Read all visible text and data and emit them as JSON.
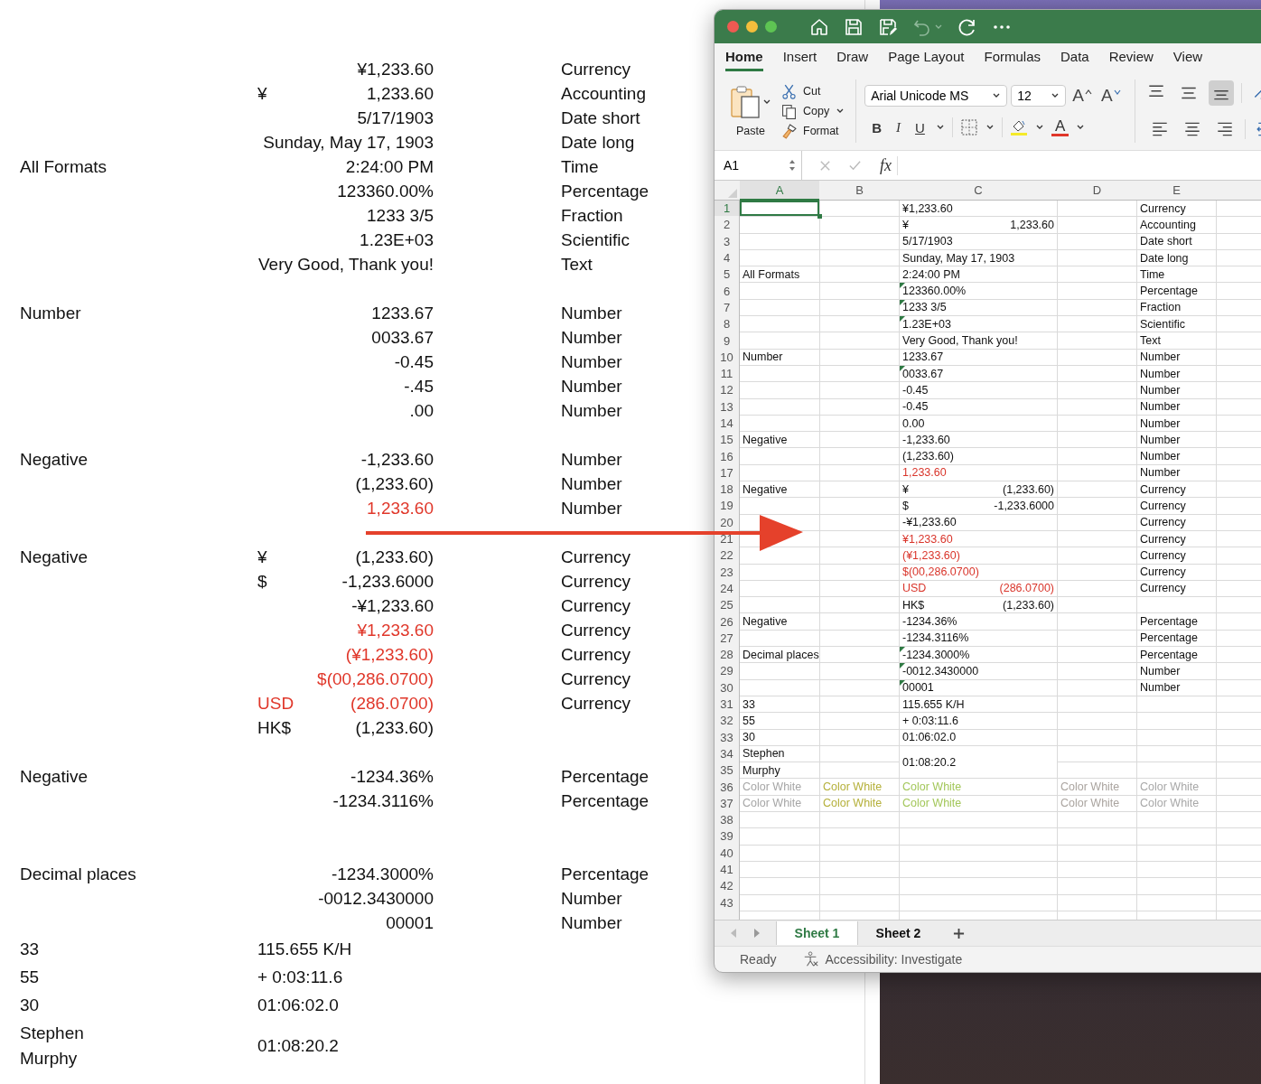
{
  "document": {
    "rows": [
      {
        "kind": "entry",
        "value": "¥1,233.60",
        "type": "Currency",
        "red": false
      },
      {
        "kind": "entry",
        "symbol": "¥",
        "value": "1,233.60",
        "type": "Accounting",
        "red": false
      },
      {
        "kind": "entry",
        "value": "5/17/1903",
        "type": "Date short",
        "red": false
      },
      {
        "kind": "entry",
        "value": "Sunday, May 17, 1903",
        "type": "Date long",
        "red": false
      },
      {
        "kind": "entry",
        "label": "All Formats",
        "value": "2:24:00 PM",
        "type": "Time",
        "red": false
      },
      {
        "kind": "entry",
        "value": "123360.00%",
        "type": "Percentage",
        "red": false
      },
      {
        "kind": "entry",
        "value": "1233 3/5",
        "type": "Fraction",
        "red": false
      },
      {
        "kind": "entry",
        "value": "1.23E+03",
        "type": "Scientific",
        "red": false
      },
      {
        "kind": "entry",
        "value": "Very Good, Thank you!",
        "type": "Text",
        "red": false
      },
      {
        "kind": "blank"
      },
      {
        "kind": "entry",
        "label": "Number",
        "value": "1233.67",
        "type": "Number",
        "red": false
      },
      {
        "kind": "entry",
        "value": "0033.67",
        "type": "Number",
        "red": false
      },
      {
        "kind": "entry",
        "value": "-0.45",
        "type": "Number",
        "red": false
      },
      {
        "kind": "entry",
        "value": "-.45",
        "type": "Number",
        "red": false
      },
      {
        "kind": "entry",
        "value": ".00",
        "type": "Number",
        "red": false
      },
      {
        "kind": "blank"
      },
      {
        "kind": "entry",
        "label": "Negative",
        "value": "-1,233.60",
        "type": "Number",
        "red": false
      },
      {
        "kind": "entry",
        "value": "(1,233.60)",
        "type": "Number",
        "red": false
      },
      {
        "kind": "entry",
        "value": "1,233.60",
        "type": "Number",
        "red": true
      },
      {
        "kind": "blank"
      },
      {
        "kind": "entry",
        "label": "Negative",
        "symbol": "¥",
        "value": "(1,233.60)",
        "type": "Currency",
        "red": false
      },
      {
        "kind": "entry",
        "symbol": "$",
        "value": "-1,233.6000",
        "type": "Currency",
        "red": false
      },
      {
        "kind": "entry",
        "value": "-¥1,233.60",
        "type": "Currency",
        "red": false
      },
      {
        "kind": "entry",
        "value": "¥1,233.60",
        "type": "Currency",
        "red": true
      },
      {
        "kind": "entry",
        "value": "(¥1,233.60)",
        "type": "Currency",
        "red": true
      },
      {
        "kind": "entry",
        "value": "$(00,286.0700)",
        "type": "Currency",
        "red": true
      },
      {
        "kind": "entry",
        "symbol": "USD",
        "value": "(286.0700)",
        "type": "Currency",
        "red": true
      },
      {
        "kind": "entry",
        "symbol": "HK$",
        "value": "(1,233.60)",
        "red": false
      },
      {
        "kind": "blank"
      },
      {
        "kind": "entry",
        "label": "Negative",
        "value": "-1234.36%",
        "type": "Percentage",
        "red": false
      },
      {
        "kind": "entry",
        "value": "-1234.3116%",
        "type": "Percentage",
        "red": false
      },
      {
        "kind": "blank"
      },
      {
        "kind": "blank"
      },
      {
        "kind": "entry",
        "label": "Decimal places",
        "value": "-1234.3000%",
        "type": "Percentage",
        "red": false
      },
      {
        "kind": "entry",
        "value": "-0012.3430000",
        "type": "Number",
        "red": false
      },
      {
        "kind": "entry",
        "value": "00001",
        "type": "Number",
        "red": false
      },
      {
        "kind": "timing",
        "label_lines": [
          "33"
        ],
        "value": "115.655 K/H"
      },
      {
        "kind": "timing",
        "label_lines": [
          "55"
        ],
        "value": "+ 0:03:11.6"
      },
      {
        "kind": "timing",
        "label_lines": [
          "30"
        ],
        "value": "01:06:02.0"
      },
      {
        "kind": "timing",
        "label_lines": [
          "Stephen",
          "Murphy"
        ],
        "value": "01:08:20.2"
      }
    ]
  },
  "window": {
    "tabs": [
      {
        "label": "Home",
        "selected": true
      },
      {
        "label": "Insert",
        "selected": false
      },
      {
        "label": "Draw",
        "selected": false
      },
      {
        "label": "Page Layout",
        "selected": false
      },
      {
        "label": "Formulas",
        "selected": false
      },
      {
        "label": "Data",
        "selected": false
      },
      {
        "label": "Review",
        "selected": false
      },
      {
        "label": "View",
        "selected": false
      }
    ],
    "ribbon": {
      "paste": "Paste",
      "cut": "Cut",
      "copy": "Copy",
      "format": "Format",
      "font": "Arial Unicode MS",
      "size": "12",
      "grow": "A",
      "shrink": "A",
      "bold": "B",
      "italic": "I",
      "underline": "U",
      "font_color": "A"
    },
    "formula_bar": {
      "name_box": "A1",
      "fx": "fx"
    },
    "sheet": {
      "columns": [
        {
          "label": "A",
          "selected": true
        },
        {
          "label": "B",
          "selected": false
        },
        {
          "label": "C",
          "selected": false
        },
        {
          "label": "D",
          "selected": false
        },
        {
          "label": "E",
          "selected": false
        }
      ],
      "rows": [
        {
          "n": "1",
          "kind": "plain",
          "c": "¥1,233.60",
          "e": "Currency",
          "red": false,
          "flag": false,
          "selected": true
        },
        {
          "n": "2",
          "kind": "plain",
          "c_symbol": "¥",
          "c": "1,233.60",
          "e": "Accounting",
          "red": false,
          "flag": false,
          "selected": false
        },
        {
          "n": "3",
          "kind": "plain",
          "c": "5/17/1903",
          "e": "Date short",
          "red": false,
          "flag": false,
          "selected": false
        },
        {
          "n": "4",
          "kind": "plain",
          "c": "Sunday, May 17, 1903",
          "e": "Date long",
          "red": false,
          "flag": false,
          "selected": false
        },
        {
          "n": "5",
          "kind": "plain",
          "a": "All Formats",
          "c": "2:24:00 PM",
          "e": "Time",
          "red": false,
          "flag": false,
          "selected": false
        },
        {
          "n": "6",
          "kind": "plain",
          "c": "123360.00%",
          "e": "Percentage",
          "red": false,
          "flag": true,
          "selected": false
        },
        {
          "n": "7",
          "kind": "plain",
          "c": "1233 3/5",
          "e": "Fraction",
          "red": false,
          "flag": true,
          "selected": false
        },
        {
          "n": "8",
          "kind": "plain",
          "c": "1.23E+03",
          "e": "Scientific",
          "red": false,
          "flag": true,
          "selected": false
        },
        {
          "n": "9",
          "kind": "plain",
          "c": "Very Good, Thank you!",
          "e": "Text",
          "red": false,
          "flag": false,
          "selected": false
        },
        {
          "n": "10",
          "kind": "plain",
          "a": "Number",
          "c": "1233.67",
          "e": "Number",
          "red": false,
          "flag": false,
          "selected": false
        },
        {
          "n": "11",
          "kind": "plain",
          "c": "0033.67",
          "e": "Number",
          "red": false,
          "flag": true,
          "selected": false
        },
        {
          "n": "12",
          "kind": "plain",
          "c": "-0.45",
          "e": "Number",
          "red": false,
          "flag": false,
          "selected": false
        },
        {
          "n": "13",
          "kind": "plain",
          "c": "-0.45",
          "e": "Number",
          "red": false,
          "flag": false,
          "selected": false
        },
        {
          "n": "14",
          "kind": "plain",
          "c": "0.00",
          "e": "Number",
          "red": false,
          "flag": false,
          "selected": false
        },
        {
          "n": "15",
          "kind": "plain",
          "a": "Negative",
          "c": "-1,233.60",
          "e": "Number",
          "red": false,
          "flag": false,
          "selected": false
        },
        {
          "n": "16",
          "kind": "plain",
          "c": "(1,233.60)",
          "e": "Number",
          "red": false,
          "flag": false,
          "selected": false
        },
        {
          "n": "17",
          "kind": "plain",
          "c": "1,233.60",
          "e": "Number",
          "red": true,
          "flag": false,
          "selected": false
        },
        {
          "n": "18",
          "kind": "plain",
          "a": "Negative",
          "c_symbol": "¥",
          "c": "(1,233.60)",
          "e": "Currency",
          "red": false,
          "flag": false,
          "selected": false
        },
        {
          "n": "19",
          "kind": "plain",
          "c_symbol": "$",
          "c": "-1,233.6000",
          "e": "Currency",
          "red": false,
          "flag": false,
          "selected": false
        },
        {
          "n": "20",
          "kind": "plain",
          "c": "-¥1,233.60",
          "e": "Currency",
          "red": false,
          "flag": false,
          "selected": false
        },
        {
          "n": "21",
          "kind": "plain",
          "c": "¥1,233.60",
          "e": "Currency",
          "red": true,
          "flag": false,
          "selected": false
        },
        {
          "n": "22",
          "kind": "plain",
          "c": "(¥1,233.60)",
          "e": "Currency",
          "red": true,
          "flag": false,
          "selected": false
        },
        {
          "n": "23",
          "kind": "plain",
          "c": "$(00,286.0700)",
          "e": "Currency",
          "red": true,
          "flag": false,
          "selected": false
        },
        {
          "n": "24",
          "kind": "plain",
          "c_symbol": "USD",
          "c": "(286.0700)",
          "e": "Currency",
          "red": true,
          "flag": false,
          "selected": false
        },
        {
          "n": "25",
          "kind": "plain",
          "c_symbol": "HK$",
          "c": "(1,233.60)",
          "red": false,
          "flag": false,
          "selected": false
        },
        {
          "n": "26",
          "kind": "plain",
          "a": "Negative",
          "c": "-1234.36%",
          "e": "Percentage",
          "red": false,
          "flag": false,
          "selected": false
        },
        {
          "n": "27",
          "kind": "plain",
          "c": "-1234.3116%",
          "e": "Percentage",
          "red": false,
          "flag": false,
          "selected": false
        },
        {
          "n": "28",
          "kind": "plain",
          "a": "Decimal places",
          "c": "-1234.3000%",
          "e": "Percentage",
          "red": false,
          "flag": true,
          "selected": false
        },
        {
          "n": "29",
          "kind": "plain",
          "c": "-0012.3430000",
          "e": "Number",
          "red": false,
          "flag": true,
          "selected": false
        },
        {
          "n": "30",
          "kind": "plain",
          "c": "00001",
          "e": "Number",
          "red": false,
          "flag": true,
          "selected": false
        },
        {
          "n": "31",
          "kind": "plain",
          "a": "33",
          "c": "115.655 K/H",
          "red": false,
          "flag": false,
          "selected": false
        },
        {
          "n": "32",
          "kind": "plain",
          "a": "55",
          "c": "+ 0:03:11.6",
          "red": false,
          "flag": false,
          "selected": false
        },
        {
          "n": "33",
          "kind": "plain",
          "a": "30",
          "c": "01:06:02.0",
          "red": false,
          "flag": false,
          "selected": false
        },
        {
          "n": "34",
          "kind": "merged",
          "a": "Stephen",
          "c": "01:08:20.2",
          "red": false,
          "flag": false,
          "selected": false
        },
        {
          "n": "35",
          "kind": "plain",
          "a": "Murphy",
          "selected": false
        },
        {
          "n": "36",
          "kind": "colored",
          "cells": [
            {
              "text": "Color White",
              "color": "#a6a6a6"
            },
            {
              "text": "Color White",
              "color": "#b5b03a"
            },
            {
              "text": "Color White",
              "color": "#a3c75a"
            },
            {
              "text": "Color White",
              "color": "#aaa49f"
            },
            {
              "text": "Color White",
              "color": "#a8a8a8"
            }
          ],
          "selected": false
        },
        {
          "n": "37",
          "kind": "colored",
          "cells": [
            {
              "text": "Color White",
              "color": "#a6a6a6"
            },
            {
              "text": "Color White",
              "color": "#b5b03a"
            },
            {
              "text": "Color White",
              "color": "#a3c75a"
            },
            {
              "text": "Color White",
              "color": "#aaa49f"
            },
            {
              "text": "Color White",
              "color": "#a8a8a8"
            }
          ],
          "selected": false
        },
        {
          "n": "38",
          "kind": "empty",
          "selected": false
        },
        {
          "n": "39",
          "kind": "empty",
          "selected": false
        },
        {
          "n": "40",
          "kind": "empty",
          "selected": false
        },
        {
          "n": "41",
          "kind": "empty",
          "selected": false
        },
        {
          "n": "42",
          "kind": "empty",
          "selected": false
        },
        {
          "n": "43",
          "kind": "empty",
          "selected": false
        }
      ]
    },
    "sheet_tabs": [
      {
        "label": "Sheet 1",
        "selected": true
      },
      {
        "label": "Sheet 2",
        "selected": false
      }
    ],
    "status": {
      "ready": "Ready",
      "accessibility": "Accessibility: Investigate"
    }
  }
}
